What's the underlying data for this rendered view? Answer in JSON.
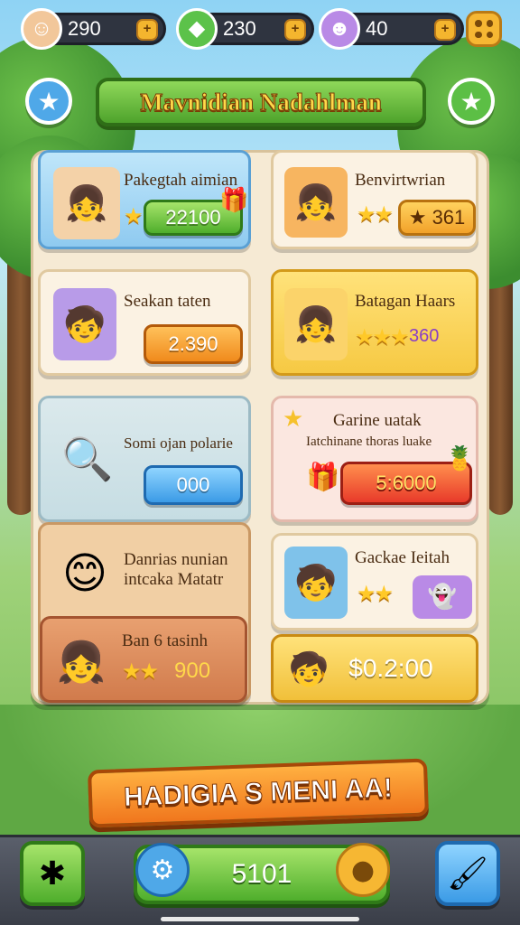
{
  "topbar": {
    "resources": [
      {
        "value": "290",
        "icon": "girl-avatar-icon"
      },
      {
        "value": "230",
        "icon": "green-gem-icon"
      },
      {
        "value": "40",
        "icon": "purple-ghost-icon"
      }
    ],
    "menu_icon": "menu-grid-icon"
  },
  "title": "Mavnidian Nadahlman",
  "cards": {
    "c1": {
      "title": "Pakegtah aimian",
      "button": "22100"
    },
    "c2": {
      "title": "Benvirtwrian",
      "button": "361"
    },
    "c3": {
      "title": "Seakan taten",
      "button": "2.390"
    },
    "c4": {
      "title": "Batagan Haars",
      "value": "360"
    },
    "c5": {
      "title": "Somi ojan polarie",
      "button": "000"
    },
    "c6": {
      "title": "Garine uatak",
      "subtitle": "Iatchinane thoras luake",
      "button": "5:6000"
    },
    "c7": {
      "title": "Danrias nunian",
      "subtitle": "intcaka Matatr"
    },
    "c8": {
      "title": "Gackae Ieitah"
    },
    "c9": {
      "title": "Ban 6 tasinh",
      "value": "900"
    },
    "c10": {
      "button": "$0.2:00"
    }
  },
  "cta": "HADIGIA S MENI AA!",
  "bottom": {
    "center_value": "5101"
  },
  "colors": {
    "accent_green": "#4fae2c",
    "accent_orange": "#f08a1c",
    "board": "#f6ead4"
  }
}
